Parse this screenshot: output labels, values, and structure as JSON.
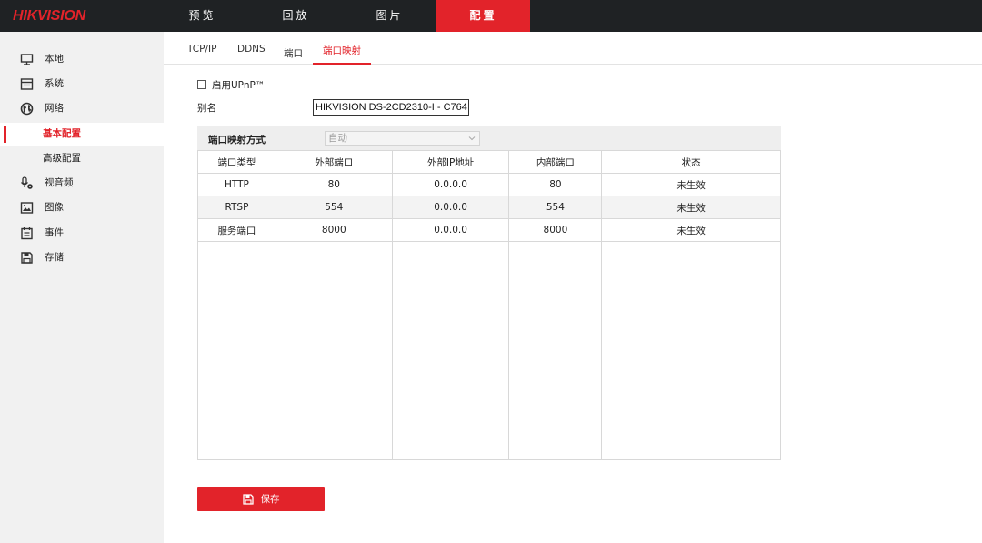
{
  "brand": {
    "logo_text": "HIKVISION"
  },
  "top_nav": [
    {
      "label": "预览"
    },
    {
      "label": "回放"
    },
    {
      "label": "图片"
    },
    {
      "label": "配置"
    }
  ],
  "sidebar": {
    "items": [
      {
        "label": "本地"
      },
      {
        "label": "系统"
      },
      {
        "label": "网络"
      },
      {
        "label": "基本配置"
      },
      {
        "label": "高级配置"
      },
      {
        "label": "视音频"
      },
      {
        "label": "图像"
      },
      {
        "label": "事件"
      },
      {
        "label": "存储"
      }
    ]
  },
  "tabs": [
    {
      "label": "TCP/IP"
    },
    {
      "label": "DDNS"
    },
    {
      "label": "端口"
    },
    {
      "label": "端口映射"
    }
  ],
  "form": {
    "upnp_label": "启用UPnP™",
    "alias_label": "别名",
    "alias_value": "HIKVISION DS-2CD2310-I - C764"
  },
  "mapping": {
    "mode_label": "端口映射方式",
    "mode_value": "自动"
  },
  "table": {
    "headers": [
      "端口类型",
      "外部端口",
      "外部IP地址",
      "内部端口",
      "状态"
    ],
    "rows": [
      [
        "HTTP",
        "80",
        "0.0.0.0",
        "80",
        "未生效"
      ],
      [
        "RTSP",
        "554",
        "0.0.0.0",
        "554",
        "未生效"
      ],
      [
        "服务端口",
        "8000",
        "0.0.0.0",
        "8000",
        "未生效"
      ]
    ]
  },
  "actions": {
    "save_label": "保存"
  },
  "colors": {
    "accent": "#e2232a",
    "topbar": "#1f2224",
    "sidebar": "#f1f1f1"
  }
}
